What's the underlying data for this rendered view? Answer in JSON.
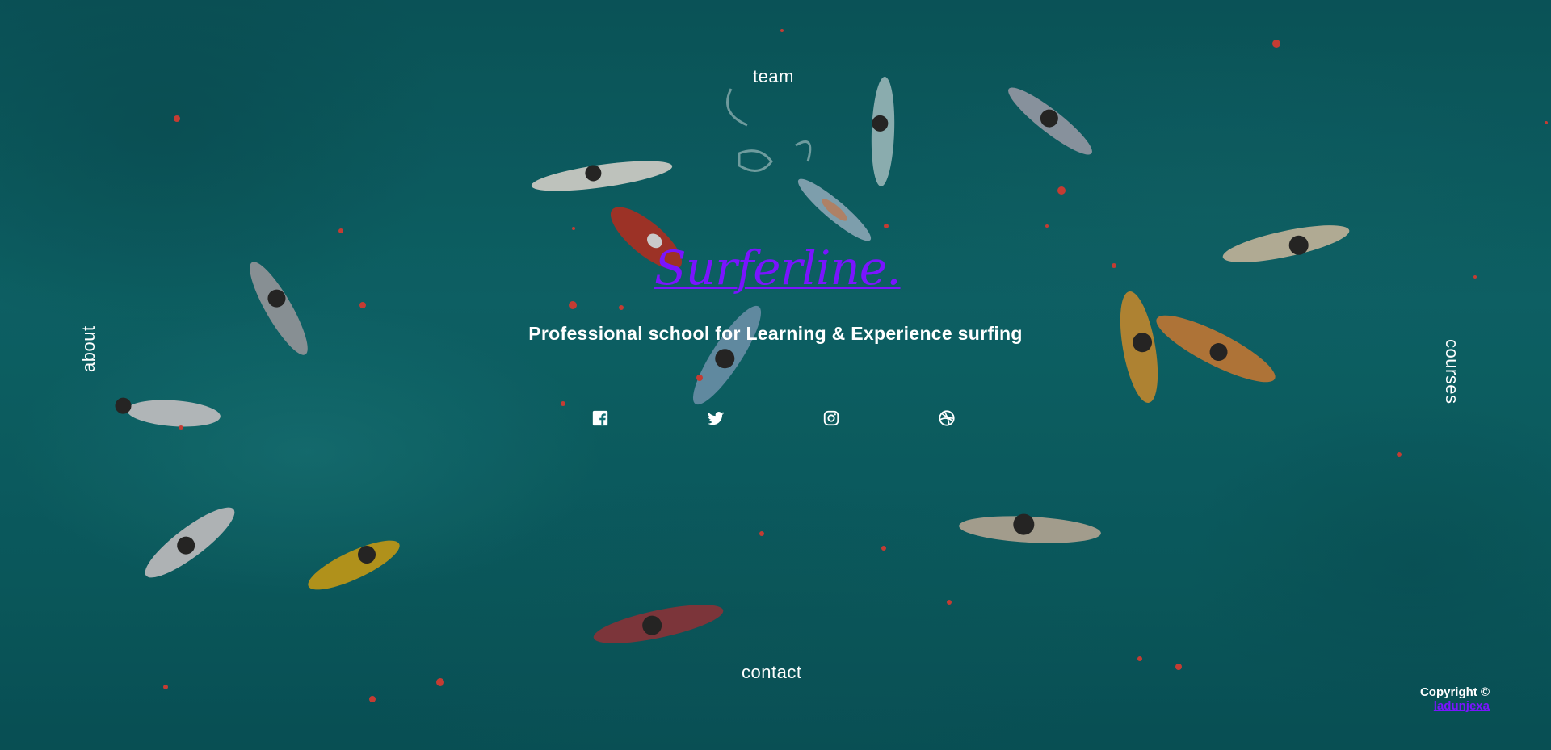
{
  "nav": {
    "team": "team",
    "about": "about",
    "courses": "courses",
    "contact": "contact"
  },
  "brand": {
    "logo": "Surferline.",
    "tagline": "Professional school for Learning & Experience surfing",
    "accent_color": "#7a14ff"
  },
  "socials": [
    {
      "icon": "facebook-icon"
    },
    {
      "icon": "twitter-icon"
    },
    {
      "icon": "instagram-icon"
    },
    {
      "icon": "dribbble-icon"
    }
  ],
  "footer": {
    "copyright": "Copyright ©",
    "author": "ladunjexa"
  },
  "colors": {
    "ocean": "#0f6d71",
    "particle": "#e0453b",
    "text": "#ffffff"
  }
}
